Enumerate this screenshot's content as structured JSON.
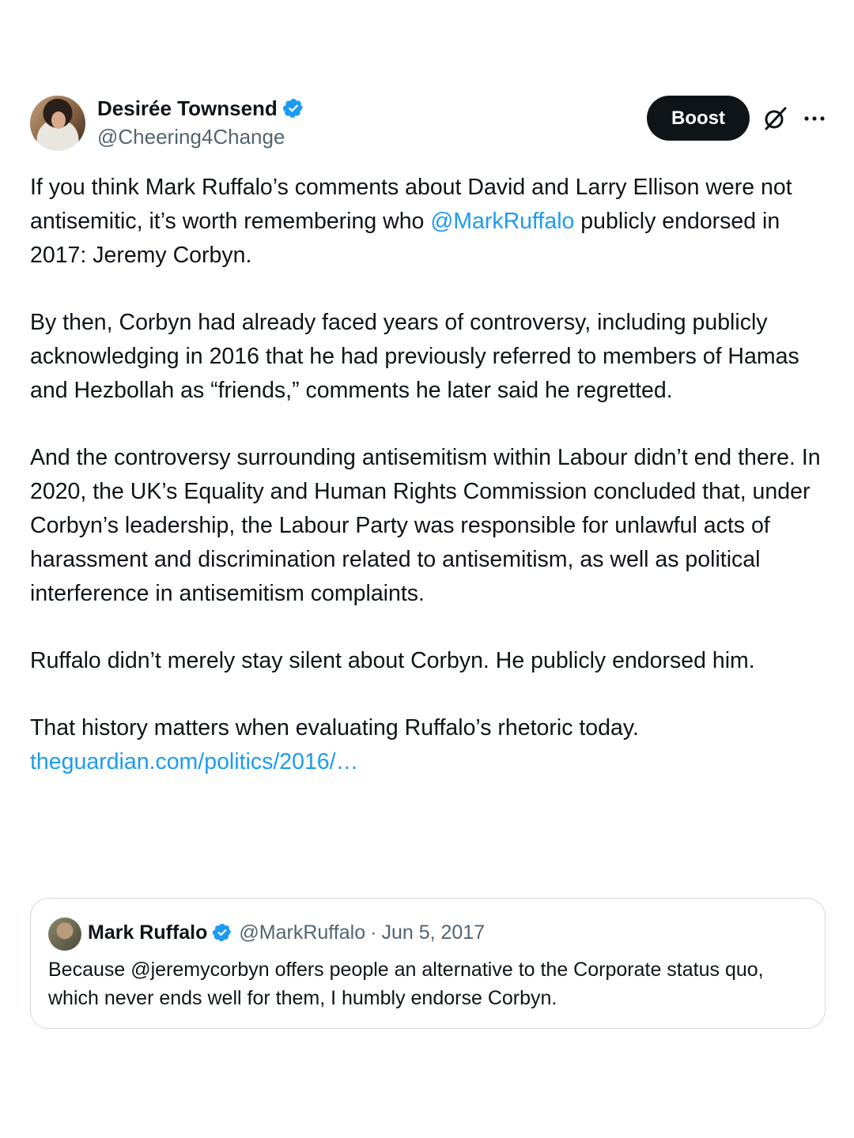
{
  "author": {
    "name": "Desirée Townsend",
    "handle": "@Cheering4Change"
  },
  "actions": {
    "boost_label": "Boost"
  },
  "post": {
    "p1_a": "If you think Mark Ruffalo’s comments about David and Larry Ellison were not antisemitic, it’s worth remembering who ",
    "p1_mention": "@MarkRuffalo",
    "p1_b": " publicly endorsed in 2017: Jeremy Corbyn.",
    "p2": "By then, Corbyn had already faced years of controversy, including publicly acknowledging in 2016 that he had previously referred to members of Hamas and Hezbollah as “friends,” comments he later said he regretted.",
    "p3": "And the controversy surrounding antisemitism within Labour didn’t end there. In 2020, the UK’s Equality and Human Rights Commission concluded that, under Corbyn’s leadership, the Labour Party was responsible for unlawful acts of harassment and discrimination related to antisemitism, as well as political interference in antisemitism complaints.",
    "p4": "Ruffalo didn’t merely stay silent about Corbyn. He publicly endorsed him.",
    "p5": "That history matters when evaluating Ruffalo’s rhetoric today.",
    "link": "theguardian.com/politics/2016/…"
  },
  "quote": {
    "name": "Mark Ruffalo",
    "handle": "@MarkRuffalo",
    "separator": "·",
    "date": "Jun 5, 2017",
    "text": "Because @jeremycorbyn  offers people an alternative to the Corporate status quo, which never ends well for them, I humbly endorse Corbyn."
  },
  "colors": {
    "link": "#1d9bf0",
    "verified": "#1d9bf0",
    "secondary_text": "#536471"
  },
  "icons": [
    "verified-badge-icon",
    "grok-icon",
    "more-icon"
  ]
}
